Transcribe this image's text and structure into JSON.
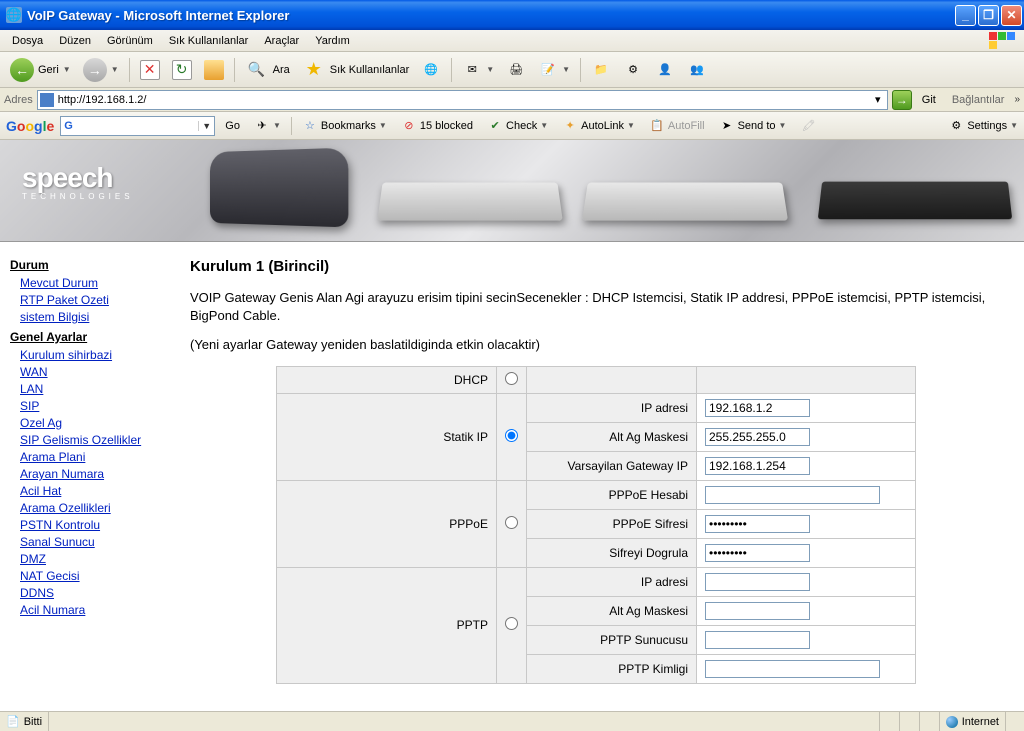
{
  "window": {
    "title": "VoIP Gateway - Microsoft Internet Explorer"
  },
  "menu": [
    "Dosya",
    "Düzen",
    "Görünüm",
    "Sık Kullanılanlar",
    "Araçlar",
    "Yardım"
  ],
  "toolbar": {
    "back": "Geri",
    "search": "Ara",
    "favorites": "Sık Kullanılanlar"
  },
  "address": {
    "label": "Adres",
    "url": "http://192.168.1.2/",
    "go": "Git",
    "links": "Bağlantılar"
  },
  "googlebar": {
    "go": "Go",
    "bookmarks": "Bookmarks",
    "blocked": "15 blocked",
    "check": "Check",
    "autolink": "AutoLink",
    "autofill": "AutoFill",
    "sendto": "Send to",
    "settings": "Settings"
  },
  "banner": {
    "brand": "speech",
    "sub": "TECHNOLOGIES"
  },
  "sidebar": {
    "sections": [
      {
        "title": "Durum",
        "items": [
          "Mevcut Durum",
          "RTP Paket Ozeti",
          "sistem Bilgisi"
        ]
      },
      {
        "title": "Genel Ayarlar",
        "items": [
          "Kurulum sihirbazi",
          "WAN",
          "LAN",
          "SIP",
          "Ozel Ag",
          "SIP Gelismis Ozellikler",
          "Arama Plani",
          "Arayan Numara",
          "Acil Hat",
          "Arama Ozellikleri",
          "PSTN Kontrolu",
          "Sanal Sunucu",
          "DMZ",
          "NAT Gecisi",
          "DDNS",
          "Acil Numara"
        ]
      }
    ]
  },
  "page": {
    "heading": "Kurulum 1 (Birincil)",
    "desc1": "VOIP Gateway Genis Alan Agi arayuzu erisim tipini secinSecenekler : DHCP Istemcisi, Statik IP addresi, PPPoE istemcisi, PPTP istemcisi, BigPond Cable.",
    "desc2": "(Yeni ayarlar Gateway yeniden baslatildiginda etkin olacaktir)"
  },
  "form": {
    "dhcp": {
      "label": "DHCP",
      "checked": false
    },
    "static": {
      "label": "Statik IP",
      "checked": true,
      "ip_label": "IP adresi",
      "ip": "192.168.1.2",
      "mask_label": "Alt Ag Maskesi",
      "mask": "255.255.255.0",
      "gw_label": "Varsayilan Gateway IP",
      "gw": "192.168.1.254"
    },
    "pppoe": {
      "label": "PPPoE",
      "checked": false,
      "account_label": "PPPoE Hesabi",
      "account": "",
      "pass_label": "PPPoE Sifresi",
      "pass": "•••••••••",
      "confirm_label": "Sifreyi Dogrula",
      "confirm": "•••••••••"
    },
    "pptp": {
      "label": "PPTP",
      "checked": false,
      "ip_label": "IP adresi",
      "ip": "",
      "mask_label": "Alt Ag Maskesi",
      "mask": "",
      "server_label": "PPTP Sunucusu",
      "server": "",
      "id_label": "PPTP Kimligi",
      "id": ""
    }
  },
  "status": {
    "done": "Bitti",
    "zone": "Internet"
  }
}
